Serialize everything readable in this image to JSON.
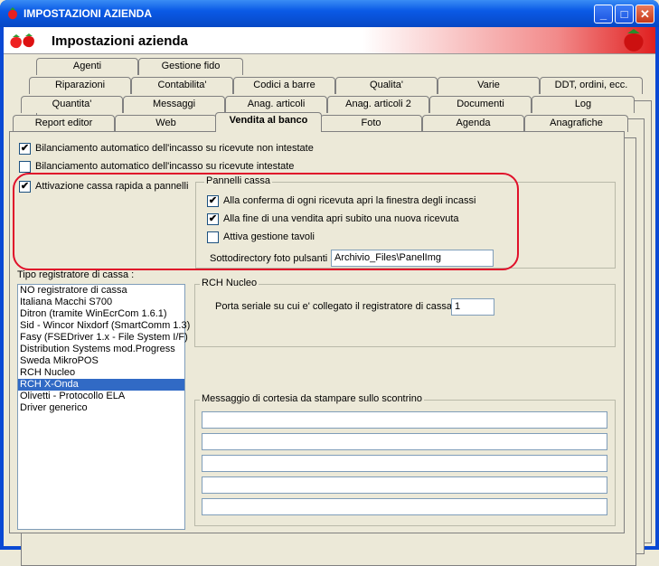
{
  "window": {
    "title": "IMPOSTAZIONI AZIENDA",
    "minimize": "_",
    "maximize": "□",
    "close": "✕"
  },
  "header": {
    "title": "Impostazioni azienda"
  },
  "tabs": {
    "row1": [
      "Agenti",
      "Gestione fido"
    ],
    "row2": [
      "Riparazioni",
      "Contabilita'",
      "Codici a barre",
      "Qualita'",
      "Varie",
      "DDT, ordini, ecc."
    ],
    "row3": [
      "Quantita'",
      "Messaggi",
      "Anag. articoli",
      "Anag. articoli 2",
      "Documenti",
      "Log"
    ],
    "row4": [
      "Report editor",
      "Web",
      "Vendita al banco",
      "Foto",
      "Agenda",
      "Anagrafiche"
    ]
  },
  "options": {
    "bilanciamento_non_intestate": {
      "label": "Bilanciamento automatico dell'incasso su ricevute non intestate",
      "checked": "✔"
    },
    "bilanciamento_intestate": {
      "label": "Bilanciamento automatico dell'incasso su ricevute intestate",
      "checked": ""
    },
    "cassa_rapida": {
      "label": "Attivazione cassa rapida a pannelli",
      "checked": "✔"
    }
  },
  "pannelli": {
    "title": "Pannelli cassa",
    "conferma": {
      "label": "Alla conferma di ogni ricevuta apri la finestra degli incassi",
      "checked": "✔"
    },
    "fine_vendita": {
      "label": "Alla fine di una vendita apri subito una nuova ricevuta",
      "checked": "✔"
    },
    "tavoli": {
      "label": "Attiva gestione tavoli",
      "checked": ""
    },
    "sottodir_label": "Sottodirectory foto pulsanti :",
    "sottodir_value": "Archivio_Files\\PanelImg"
  },
  "registratore": {
    "label": "Tipo registratore di cassa :",
    "items": [
      "NO registratore di cassa",
      "Italiana Macchi S700",
      "Ditron (tramite WinEcrCom 1.6.1)",
      "Sid - Wincor Nixdorf (SmartComm 1.3)",
      "Fasy (FSEDriver 1.x - File System I/F)",
      "Distribution Systems mod.Progress",
      "Sweda MikroPOS",
      "RCH Nucleo",
      "RCH X-Onda",
      "Olivetti - Protocollo ELA",
      "Driver generico"
    ],
    "selected": "RCH X-Onda"
  },
  "rch": {
    "title": "RCH Nucleo",
    "porta_label": "Porta seriale su cui e' collegato il registratore di cassa :",
    "porta_value": "1"
  },
  "messaggio": {
    "title": "Messaggio di cortesia da stampare sullo scontrino",
    "lines": [
      "",
      "",
      "",
      "",
      ""
    ]
  },
  "colors": {
    "titlebar": "#0a5ae6",
    "highlight": "#e0102a",
    "selection": "#316ac5"
  }
}
